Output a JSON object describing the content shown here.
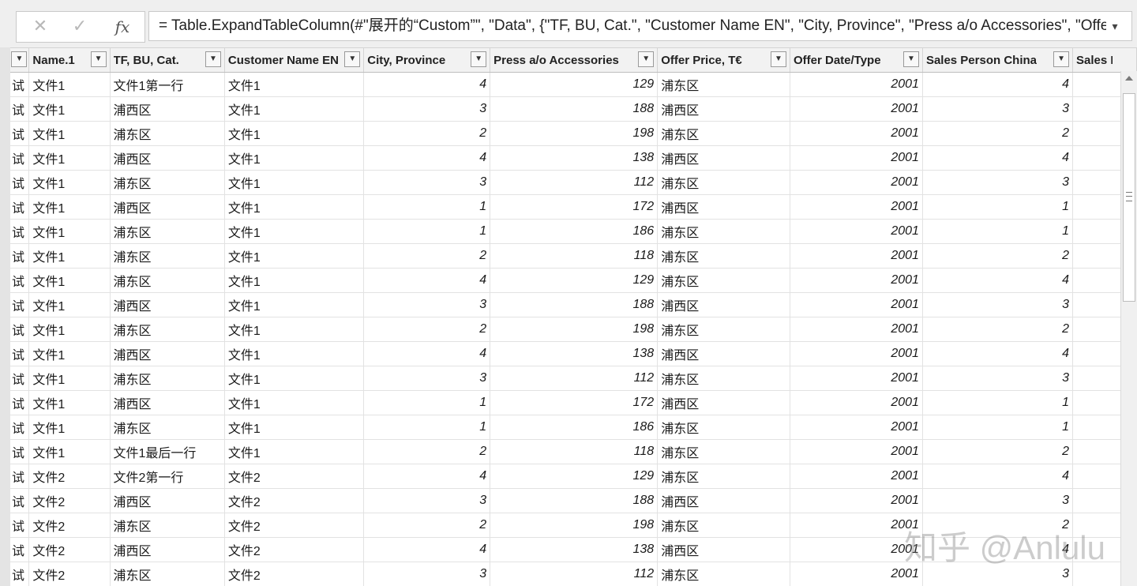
{
  "formula_bar": {
    "cancel_glyph": "✕",
    "confirm_glyph": "✓",
    "fx_glyph": "fx",
    "formula": "= Table.ExpandTableColumn(#\"展开的“Custom”\", \"Data\", {\"TF, BU, Cat.\", \"Customer Name EN\", \"City, Province\", \"Press a/o Accessories\", \"Offer",
    "expand_glyph": "▾"
  },
  "columns": [
    {
      "label": ""
    },
    {
      "label": "Name.1"
    },
    {
      "label": "TF, BU, Cat."
    },
    {
      "label": "Customer Name EN"
    },
    {
      "label": "City, Province"
    },
    {
      "label": "Press a/o Accessories"
    },
    {
      "label": "Offer Price, T€"
    },
    {
      "label": "Offer Date/Type"
    },
    {
      "label": "Sales Person China"
    },
    {
      "label": "Sales Pers"
    }
  ],
  "filter_glyph": "▼",
  "rows": [
    [
      "试",
      "文件1",
      "文件1第一行",
      "文件1",
      "4",
      "129",
      "浦东区",
      "2001",
      "4",
      ""
    ],
    [
      "试",
      "文件1",
      "浦西区",
      "文件1",
      "3",
      "188",
      "浦西区",
      "2001",
      "3",
      ""
    ],
    [
      "试",
      "文件1",
      "浦东区",
      "文件1",
      "2",
      "198",
      "浦东区",
      "2001",
      "2",
      ""
    ],
    [
      "试",
      "文件1",
      "浦西区",
      "文件1",
      "4",
      "138",
      "浦西区",
      "2001",
      "4",
      ""
    ],
    [
      "试",
      "文件1",
      "浦东区",
      "文件1",
      "3",
      "112",
      "浦东区",
      "2001",
      "3",
      ""
    ],
    [
      "试",
      "文件1",
      "浦西区",
      "文件1",
      "1",
      "172",
      "浦西区",
      "2001",
      "1",
      ""
    ],
    [
      "试",
      "文件1",
      "浦东区",
      "文件1",
      "1",
      "186",
      "浦东区",
      "2001",
      "1",
      ""
    ],
    [
      "试",
      "文件1",
      "浦东区",
      "文件1",
      "2",
      "118",
      "浦东区",
      "2001",
      "2",
      ""
    ],
    [
      "试",
      "文件1",
      "浦东区",
      "文件1",
      "4",
      "129",
      "浦东区",
      "2001",
      "4",
      ""
    ],
    [
      "试",
      "文件1",
      "浦西区",
      "文件1",
      "3",
      "188",
      "浦西区",
      "2001",
      "3",
      ""
    ],
    [
      "试",
      "文件1",
      "浦东区",
      "文件1",
      "2",
      "198",
      "浦东区",
      "2001",
      "2",
      ""
    ],
    [
      "试",
      "文件1",
      "浦西区",
      "文件1",
      "4",
      "138",
      "浦西区",
      "2001",
      "4",
      ""
    ],
    [
      "试",
      "文件1",
      "浦东区",
      "文件1",
      "3",
      "112",
      "浦东区",
      "2001",
      "3",
      ""
    ],
    [
      "试",
      "文件1",
      "浦西区",
      "文件1",
      "1",
      "172",
      "浦西区",
      "2001",
      "1",
      ""
    ],
    [
      "试",
      "文件1",
      "浦东区",
      "文件1",
      "1",
      "186",
      "浦东区",
      "2001",
      "1",
      ""
    ],
    [
      "试",
      "文件1",
      "文件1最后一行",
      "文件1",
      "2",
      "118",
      "浦东区",
      "2001",
      "2",
      ""
    ],
    [
      "试",
      "文件2",
      "文件2第一行",
      "文件2",
      "4",
      "129",
      "浦东区",
      "2001",
      "4",
      ""
    ],
    [
      "试",
      "文件2",
      "浦西区",
      "文件2",
      "3",
      "188",
      "浦西区",
      "2001",
      "3",
      ""
    ],
    [
      "试",
      "文件2",
      "浦东区",
      "文件2",
      "2",
      "198",
      "浦东区",
      "2001",
      "2",
      ""
    ],
    [
      "试",
      "文件2",
      "浦西区",
      "文件2",
      "4",
      "138",
      "浦西区",
      "2001",
      "4",
      ""
    ],
    [
      "试",
      "文件2",
      "浦东区",
      "文件2",
      "3",
      "112",
      "浦东区",
      "2001",
      "3",
      ""
    ]
  ],
  "watermark": "知乎 @Anlulu"
}
